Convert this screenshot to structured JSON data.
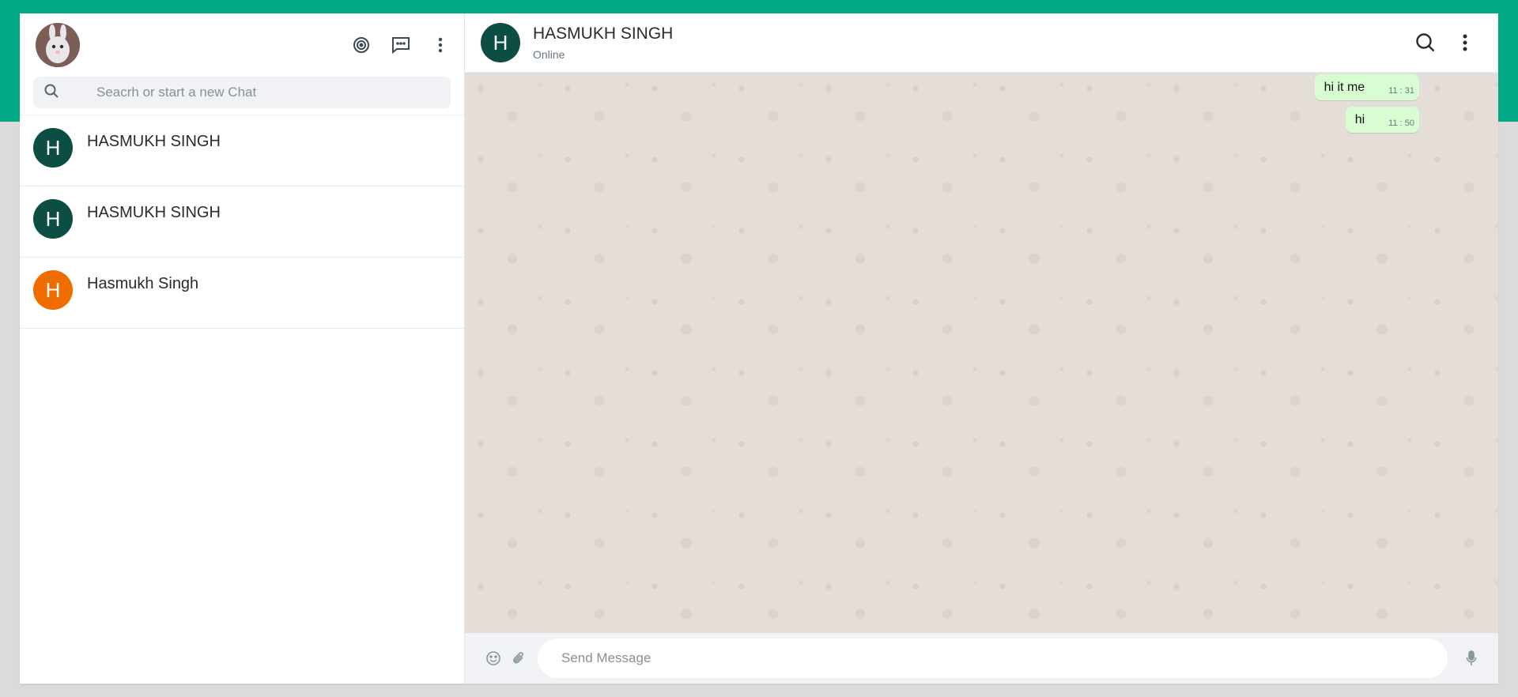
{
  "sidebar": {
    "search": {
      "placeholder": "Seacrh or start a new Chat",
      "value": ""
    },
    "chats": [
      {
        "initial": "H",
        "name": "HASMUKH SINGH",
        "color": "#0c4e43"
      },
      {
        "initial": "H",
        "name": "HASMUKH SINGH",
        "color": "#0c4e43"
      },
      {
        "initial": "H",
        "name": "Hasmukh Singh",
        "color": "#ef6c00"
      }
    ]
  },
  "conversation": {
    "initial": "H",
    "name": "HASMUKH SINGH",
    "status": "Online",
    "messages": [
      {
        "text": "hi it me",
        "time": "11 : 31"
      },
      {
        "text": "hi",
        "time": "11 : 50"
      }
    ],
    "composer": {
      "placeholder": "Send Message",
      "value": ""
    }
  },
  "theme": {
    "accent": "#00a884",
    "sent_bubble": "#d9fdd3",
    "chat_bg": "#e5ded8"
  }
}
